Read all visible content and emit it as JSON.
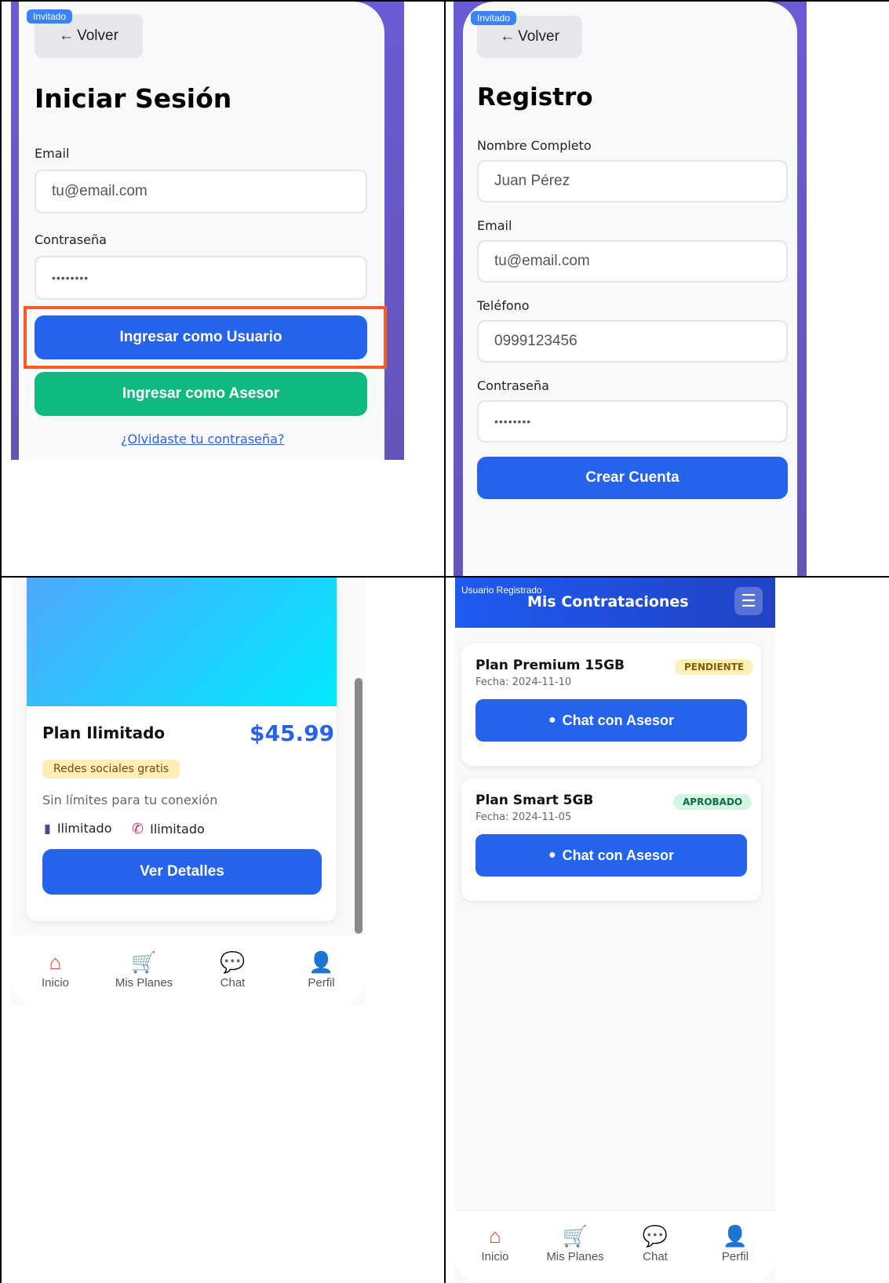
{
  "login": {
    "badge": "Invitado",
    "back_label": "Volver",
    "title": "Iniciar Sesión",
    "email_label": "Email",
    "email_placeholder": "tu@email.com",
    "password_label": "Contraseña",
    "password_value": "••••••••",
    "user_button": "Ingresar como Usuario",
    "advisor_button": "Ingresar como Asesor",
    "forgot_link": "¿Olvidaste tu contraseña?"
  },
  "register": {
    "badge": "Invitado",
    "back_label": "Volver",
    "title": "Registro",
    "name_label": "Nombre Completo",
    "name_placeholder": "Juan Pérez",
    "email_label": "Email",
    "email_placeholder": "tu@email.com",
    "phone_label": "Teléfono",
    "phone_placeholder": "0999123456",
    "password_label": "Contraseña",
    "password_value": "••••••••",
    "submit": "Crear Cuenta"
  },
  "plan": {
    "title": "Plan Ilimitado",
    "price": "$45.99",
    "tag": "Redes sociales gratis",
    "description": "Sin límites para tu conexión",
    "feature_data": "Ilimitado",
    "feature_calls": "Ilimitado",
    "details_button": "Ver Detalles"
  },
  "nav": {
    "items": [
      {
        "label": "Inicio",
        "icon": "home-icon"
      },
      {
        "label": "Mis Planes",
        "icon": "cart-icon"
      },
      {
        "label": "Chat",
        "icon": "chat-icon"
      },
      {
        "label": "Perfil",
        "icon": "user-icon"
      }
    ]
  },
  "contrataciones": {
    "user_badge": "Usuario Registrado",
    "title": "Mis Contrataciones",
    "items": [
      {
        "name": "Plan Premium 15GB",
        "status": "PENDIENTE",
        "date": "Fecha: 2024-11-10",
        "button": "Chat con Asesor"
      },
      {
        "name": "Plan Smart 5GB",
        "status": "APROBADO",
        "date": "Fecha: 2024-11-05",
        "button": "Chat con Asesor"
      }
    ]
  },
  "colors": {
    "primary": "#2563eb",
    "success": "#10b981",
    "highlight": "#ff5a1f",
    "purple": "#6654b6"
  }
}
